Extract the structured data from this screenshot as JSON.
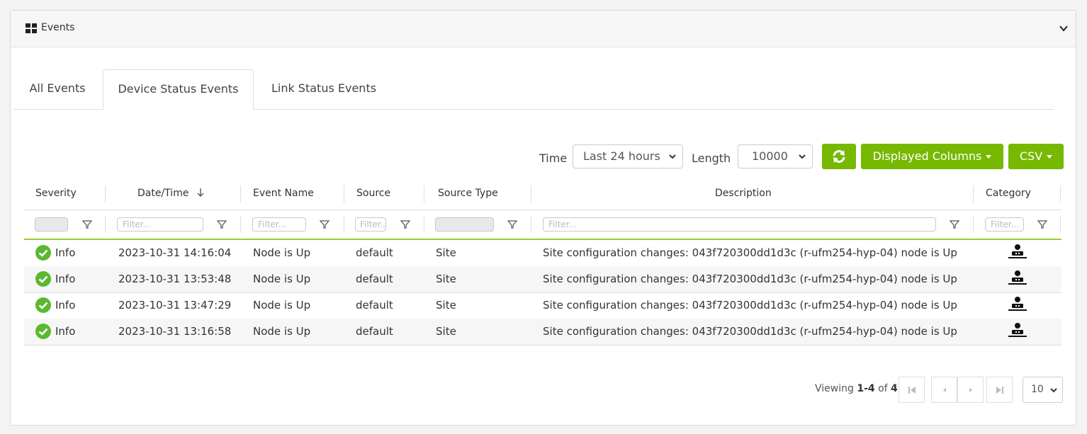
{
  "panel": {
    "title": "Events"
  },
  "tabs": [
    {
      "label": "All Events"
    },
    {
      "label": "Device Status Events"
    },
    {
      "label": "Link Status Events"
    }
  ],
  "toolbar": {
    "time_label": "Time",
    "time_value": "Last 24 hours",
    "length_label": "Length",
    "length_value": "10000",
    "refresh_icon": "refresh-icon",
    "displayed_columns_label": "Displayed Columns",
    "csv_label": "CSV"
  },
  "columns": {
    "severity": "Severity",
    "datetime": "Date/Time",
    "event_name": "Event Name",
    "source": "Source",
    "source_type": "Source Type",
    "description": "Description",
    "category": "Category"
  },
  "filters": {
    "datetime": "Filter...",
    "event_name": "Filter...",
    "source": "Filter...",
    "description": "Filter...",
    "category": "Filter..."
  },
  "rows": [
    {
      "severity": "Info",
      "datetime": "2023-10-31 14:16:04",
      "event_name": "Node is Up",
      "source": "default",
      "source_type": "Site",
      "description": "Site configuration changes: 043f720300dd1d3c (r-ufm254-hyp-04) node is Up"
    },
    {
      "severity": "Info",
      "datetime": "2023-10-31 13:53:48",
      "event_name": "Node is Up",
      "source": "default",
      "source_type": "Site",
      "description": "Site configuration changes: 043f720300dd1d3c (r-ufm254-hyp-04) node is Up"
    },
    {
      "severity": "Info",
      "datetime": "2023-10-31 13:47:29",
      "event_name": "Node is Up",
      "source": "default",
      "source_type": "Site",
      "description": "Site configuration changes: 043f720300dd1d3c (r-ufm254-hyp-04) node is Up"
    },
    {
      "severity": "Info",
      "datetime": "2023-10-31 13:16:58",
      "event_name": "Node is Up",
      "source": "default",
      "source_type": "Site",
      "description": "Site configuration changes: 043f720300dd1d3c (r-ufm254-hyp-04) node is Up"
    }
  ],
  "pagination": {
    "viewing_prefix": "Viewing",
    "viewing_range": "1-4",
    "viewing_of": "of",
    "viewing_total": "4",
    "page_size": "10"
  },
  "colors": {
    "accent": "#76b900",
    "ok": "#5cb82f"
  }
}
